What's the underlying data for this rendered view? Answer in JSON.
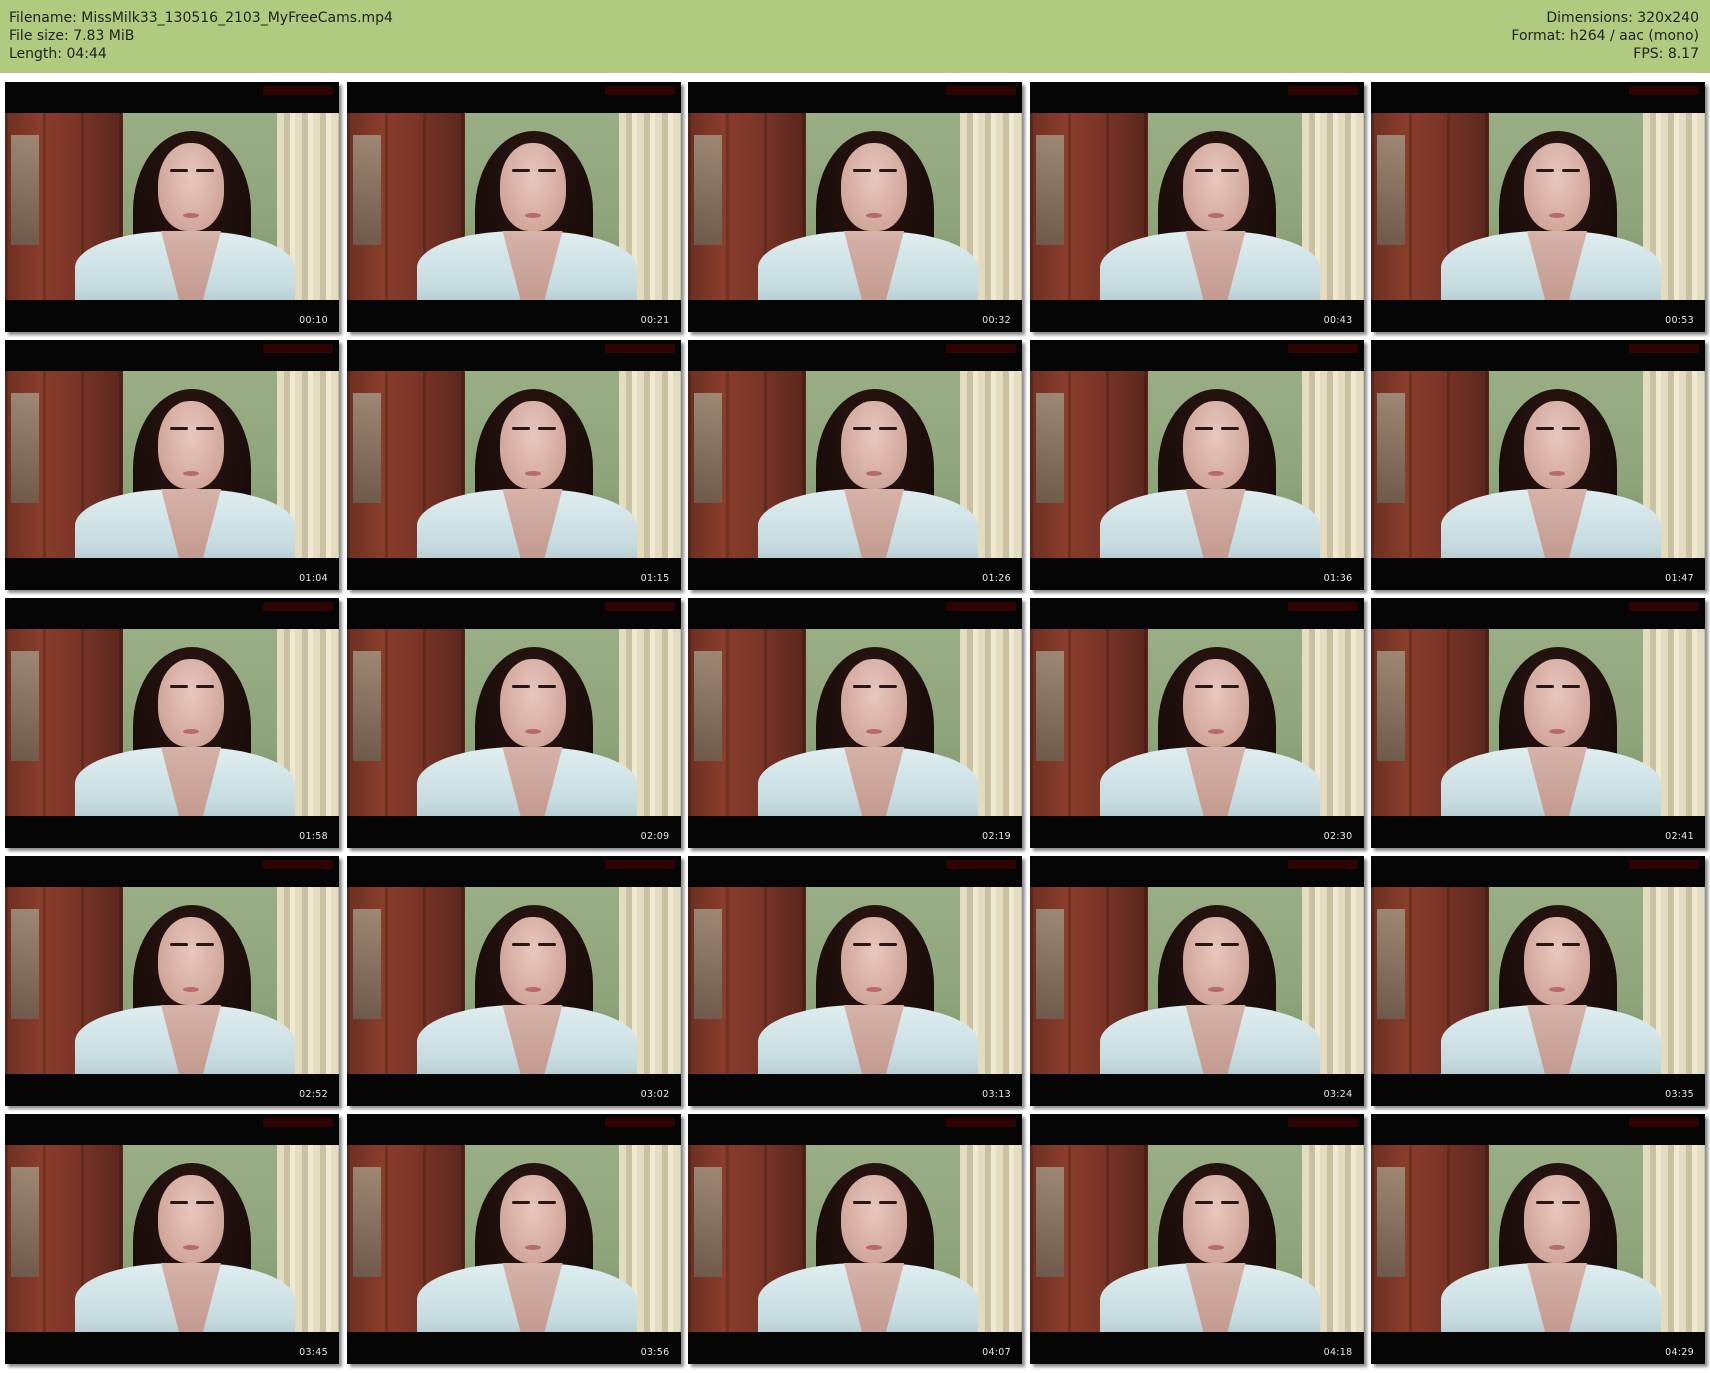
{
  "header": {
    "left": [
      "Filename: MissMilk33_130516_2103_MyFreeCams.mp4",
      "File size: 7.83 MiB",
      "Length: 04:44"
    ],
    "right": [
      "Dimensions: 320x240",
      "Format: h264 / aac (mono)",
      "FPS: 8.17"
    ],
    "background_color": "#b0cb7f"
  },
  "thumbnails": [
    {
      "timestamp": "00:10"
    },
    {
      "timestamp": "00:21"
    },
    {
      "timestamp": "00:32"
    },
    {
      "timestamp": "00:43"
    },
    {
      "timestamp": "00:53"
    },
    {
      "timestamp": "01:04"
    },
    {
      "timestamp": "01:15"
    },
    {
      "timestamp": "01:26"
    },
    {
      "timestamp": "01:36"
    },
    {
      "timestamp": "01:47"
    },
    {
      "timestamp": "01:58"
    },
    {
      "timestamp": "02:09"
    },
    {
      "timestamp": "02:19"
    },
    {
      "timestamp": "02:30"
    },
    {
      "timestamp": "02:41"
    },
    {
      "timestamp": "02:52"
    },
    {
      "timestamp": "03:02"
    },
    {
      "timestamp": "03:13"
    },
    {
      "timestamp": "03:24"
    },
    {
      "timestamp": "03:35"
    },
    {
      "timestamp": "03:45"
    },
    {
      "timestamp": "03:56"
    },
    {
      "timestamp": "04:07"
    },
    {
      "timestamp": "04:18"
    },
    {
      "timestamp": "04:29"
    }
  ]
}
